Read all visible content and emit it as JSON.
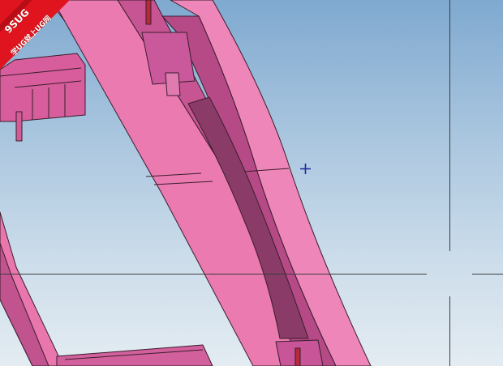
{
  "window": {
    "title": ""
  },
  "viewport": {
    "background_top": "#7fa9d0",
    "background_bottom": "#e4ecf2",
    "model_color": "#e975ad",
    "model_shadow_color": "#a93c78",
    "edge_color": "#3a1e2c"
  },
  "watermark": {
    "line1": "9SUG",
    "line2": "学UG就上UG网",
    "color": "#e0141f"
  },
  "cursor": {
    "icon": "crosshair-cursor-icon",
    "color": "#1a2aa0"
  }
}
